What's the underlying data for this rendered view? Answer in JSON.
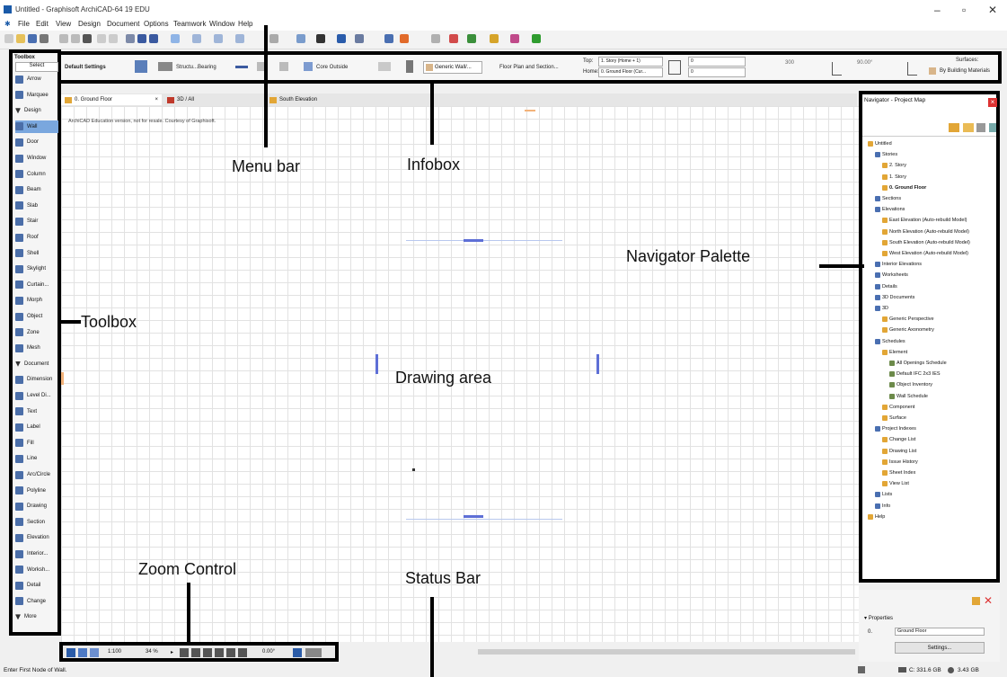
{
  "window": {
    "title": "Untitled - Graphisoft ArchiCAD-64 19 EDU",
    "controls": [
      "–",
      "▫",
      "✕"
    ]
  },
  "menubar": {
    "items": [
      "File",
      "Edit",
      "View",
      "Design",
      "Document",
      "Options",
      "Teamwork",
      "Window",
      "Help"
    ]
  },
  "infobox": {
    "default_settings": "Default Settings",
    "structure": "Structu...Bearing",
    "core": "Core Outside",
    "wall_type": "Generic Wall/...",
    "floor_plan": "Floor Plan and Section...",
    "top_label": "Top:",
    "home_label": "Home:",
    "top_value": "1. Story (Home + 1)",
    "home_value": "0. Ground Floor (Cur...",
    "zero_a": "0",
    "zero_b": "0",
    "val_300": "300",
    "angle": "90.00°",
    "surfaces_label": "Surfaces:",
    "surfaces_value": "By Building Materials"
  },
  "toolbox": {
    "title": "Toolbox",
    "select_label": "Select",
    "items": [
      {
        "label": "Arrow"
      },
      {
        "label": "Marquee"
      },
      {
        "label": "Design",
        "header": true
      },
      {
        "label": "Wall",
        "selected": true
      },
      {
        "label": "Door"
      },
      {
        "label": "Window"
      },
      {
        "label": "Column"
      },
      {
        "label": "Beam"
      },
      {
        "label": "Slab"
      },
      {
        "label": "Stair"
      },
      {
        "label": "Roof"
      },
      {
        "label": "Shell"
      },
      {
        "label": "Skylight"
      },
      {
        "label": "Curtain..."
      },
      {
        "label": "Morph"
      },
      {
        "label": "Object"
      },
      {
        "label": "Zone"
      },
      {
        "label": "Mesh"
      },
      {
        "label": "Document",
        "header": true
      },
      {
        "label": "Dimension"
      },
      {
        "label": "Level Di..."
      },
      {
        "label": "Text"
      },
      {
        "label": "Label"
      },
      {
        "label": "Fill"
      },
      {
        "label": "Line"
      },
      {
        "label": "Arc/Circle"
      },
      {
        "label": "Polyline"
      },
      {
        "label": "Drawing"
      },
      {
        "label": "Section"
      },
      {
        "label": "Elevation"
      },
      {
        "label": "Interior..."
      },
      {
        "label": "Worksh..."
      },
      {
        "label": "Detail"
      },
      {
        "label": "Change"
      },
      {
        "label": "More",
        "header": true
      }
    ]
  },
  "tabs": [
    {
      "label": "0. Ground Floor",
      "close": "×"
    },
    {
      "label": "3D / All"
    },
    {
      "label": "South Elevation"
    }
  ],
  "drawing": {
    "watermark": "ArchiCAD Education version, not for resale. Courtesy of Graphisoft."
  },
  "navigator": {
    "title": "Navigator - Project Map",
    "close": "×",
    "tree": [
      {
        "label": "Untitled",
        "level": 0
      },
      {
        "label": "Stories",
        "level": 1
      },
      {
        "label": "2. Story",
        "level": 2
      },
      {
        "label": "1. Story",
        "level": 2
      },
      {
        "label": "0. Ground Floor",
        "level": 2,
        "bold": true
      },
      {
        "label": "Sections",
        "level": 1
      },
      {
        "label": "Elevations",
        "level": 1
      },
      {
        "label": "East Elevation (Auto-rebuild Model)",
        "level": 2
      },
      {
        "label": "North Elevation (Auto-rebuild Model)",
        "level": 2
      },
      {
        "label": "South Elevation (Auto-rebuild Model)",
        "level": 2
      },
      {
        "label": "West Elevation (Auto-rebuild Model)",
        "level": 2
      },
      {
        "label": "Interior Elevations",
        "level": 1
      },
      {
        "label": "Worksheets",
        "level": 1
      },
      {
        "label": "Details",
        "level": 1
      },
      {
        "label": "3D Documents",
        "level": 1
      },
      {
        "label": "3D",
        "level": 1
      },
      {
        "label": "Generic Perspective",
        "level": 2
      },
      {
        "label": "Generic Axonometry",
        "level": 2
      },
      {
        "label": "Schedules",
        "level": 1
      },
      {
        "label": "Element",
        "level": 2
      },
      {
        "label": "All Openings Schedule",
        "level": 3
      },
      {
        "label": "Default IFC 2x3 IES",
        "level": 3
      },
      {
        "label": "Object Inventory",
        "level": 3
      },
      {
        "label": "Wall Schedule",
        "level": 3
      },
      {
        "label": "Component",
        "level": 2
      },
      {
        "label": "Surface",
        "level": 2
      },
      {
        "label": "Project Indexes",
        "level": 1
      },
      {
        "label": "Change List",
        "level": 2
      },
      {
        "label": "Drawing List",
        "level": 2
      },
      {
        "label": "Issue History",
        "level": 2
      },
      {
        "label": "Sheet Index",
        "level": 2
      },
      {
        "label": "View List",
        "level": 2
      },
      {
        "label": "Lists",
        "level": 1
      },
      {
        "label": "Info",
        "level": 1
      },
      {
        "label": "Help",
        "level": 0
      }
    ]
  },
  "properties": {
    "header": "Properties",
    "field_label": "0.",
    "field_value": "Ground Floor",
    "settings_button": "Settings..."
  },
  "zoom": {
    "scale": "1:100",
    "zoom_percent": "34 %",
    "angle": "0.00°"
  },
  "status": {
    "prompt": "Enter First Node of Wall.",
    "disk_c": "C: 331.6 GB",
    "memory": "3.43 GB"
  },
  "annotations": {
    "menu_bar": "Menu bar",
    "infobox": "Infobox",
    "navigator": "Navigator Palette",
    "toolbox": "Toolbox",
    "drawing_area": "Drawing area",
    "zoom_control": "Zoom Control",
    "status_bar": "Status Bar"
  }
}
